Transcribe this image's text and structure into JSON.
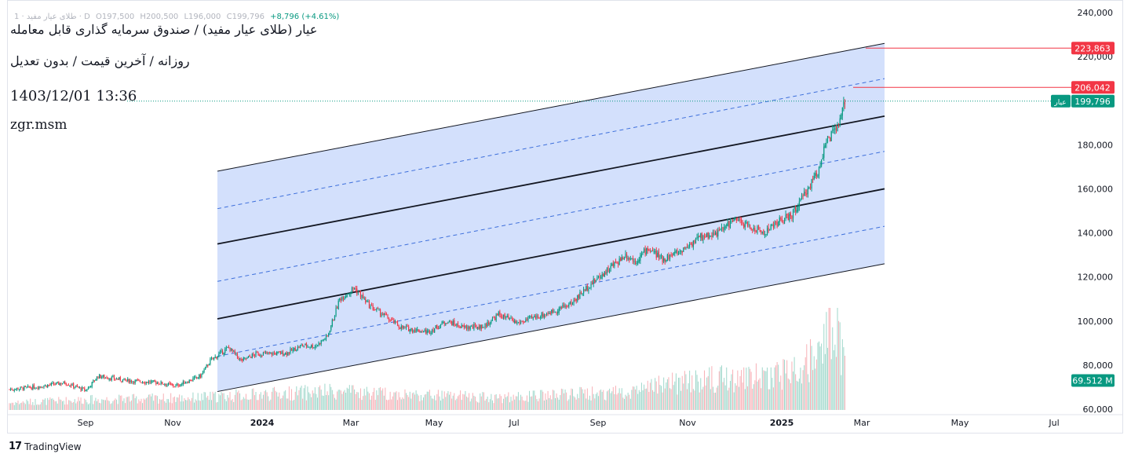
{
  "header": {
    "symbol_short": "1 · طلای عیار مفید · D",
    "open": "O197,500",
    "high": "H200,500",
    "low": "L196,000",
    "close": "C199,796",
    "change": "+8,796 (+4.61%)",
    "title": "عیار (طلای عیار مفید) / صندوق سرمایه گذاری قابل معامله",
    "subtitle": "روزانه / آخرین قیمت / بدون تعدیل",
    "datetime": "1403/12/01 13:36",
    "author": "zgr.msm"
  },
  "footer": {
    "logo": "17",
    "brand": "TradingView"
  },
  "chart_data": {
    "type": "candlestick",
    "x_tick_labels": [
      "Sep",
      "Nov",
      "2024",
      "Mar",
      "May",
      "Jul",
      "Sep",
      "Nov",
      "2025",
      "Mar",
      "May",
      "Jul"
    ],
    "y_tick_labels": [
      "240,000",
      "220,000",
      "200,000",
      "180,000",
      "160,000",
      "140,000",
      "120,000",
      "100,000",
      "80,000",
      "60,000"
    ],
    "ylim": [
      57000,
      241000
    ],
    "price_tags": [
      {
        "value": 223863,
        "label": "223,863",
        "color": "#f23645"
      },
      {
        "value": 206042,
        "label": "206,042",
        "color": "#f23645"
      },
      {
        "value": 199796,
        "label": "199,796",
        "color": "#089981",
        "name": "عیار"
      },
      {
        "value": 73000,
        "label": "69.512 M",
        "color": "#089981"
      }
    ],
    "channel": {
      "x_start_label": "Dec 2023",
      "x_end_label": "Mar 2025",
      "lines": [
        {
          "kind": "outer",
          "start": 68000,
          "end": 126000
        },
        {
          "kind": "dashed",
          "start": 84000,
          "end": 143000
        },
        {
          "kind": "solid",
          "start": 101000,
          "end": 160000
        },
        {
          "kind": "dashed",
          "start": 118000,
          "end": 177000
        },
        {
          "kind": "solid",
          "start": 135000,
          "end": 193000
        },
        {
          "kind": "dashed",
          "start": 151000,
          "end": 210000
        },
        {
          "kind": "outer",
          "start": 168000,
          "end": 226000
        }
      ]
    },
    "close_anchors": [
      [
        0,
        69000
      ],
      [
        20,
        70000
      ],
      [
        45,
        72000
      ],
      [
        62,
        68500
      ],
      [
        72,
        75000
      ],
      [
        95,
        73000
      ],
      [
        122,
        72000
      ],
      [
        135,
        70500
      ],
      [
        155,
        75000
      ],
      [
        163,
        82000
      ],
      [
        178,
        88000
      ],
      [
        188,
        82000
      ],
      [
        200,
        85000
      ],
      [
        225,
        85500
      ],
      [
        238,
        89000
      ],
      [
        248,
        88500
      ],
      [
        258,
        93000
      ],
      [
        268,
        110000
      ],
      [
        280,
        115000
      ],
      [
        292,
        107000
      ],
      [
        303,
        103000
      ],
      [
        318,
        97000
      ],
      [
        340,
        95000
      ],
      [
        355,
        100000
      ],
      [
        368,
        97000
      ],
      [
        385,
        97500
      ],
      [
        397,
        103000
      ],
      [
        412,
        99000
      ],
      [
        428,
        102000
      ],
      [
        442,
        104500
      ],
      [
        456,
        108000
      ],
      [
        470,
        116000
      ],
      [
        485,
        123000
      ],
      [
        500,
        130000
      ],
      [
        508,
        127000
      ],
      [
        518,
        133000
      ],
      [
        530,
        128000
      ],
      [
        545,
        132000
      ],
      [
        560,
        138000
      ],
      [
        575,
        140000
      ],
      [
        588,
        146000
      ],
      [
        600,
        143000
      ],
      [
        612,
        140000
      ],
      [
        624,
        145000
      ],
      [
        635,
        148000
      ],
      [
        645,
        157000
      ],
      [
        656,
        168000
      ],
      [
        662,
        180000
      ],
      [
        668,
        185000
      ],
      [
        674,
        190000
      ],
      [
        678,
        200000
      ]
    ],
    "volume_anchors": [
      [
        0,
        0.07
      ],
      [
        60,
        0.1
      ],
      [
        150,
        0.12
      ],
      [
        200,
        0.15
      ],
      [
        260,
        0.18
      ],
      [
        300,
        0.16
      ],
      [
        400,
        0.12
      ],
      [
        500,
        0.18
      ],
      [
        550,
        0.28
      ],
      [
        600,
        0.32
      ],
      [
        640,
        0.38
      ],
      [
        660,
        0.62
      ],
      [
        670,
        0.9
      ],
      [
        678,
        0.42
      ]
    ],
    "last_price": 199796
  },
  "colors": {
    "up": "#089981",
    "down": "#f23645",
    "channel_fill": "#d3e0fc",
    "dashed": "#3d6fdb",
    "grid": "#f0f3fa"
  }
}
